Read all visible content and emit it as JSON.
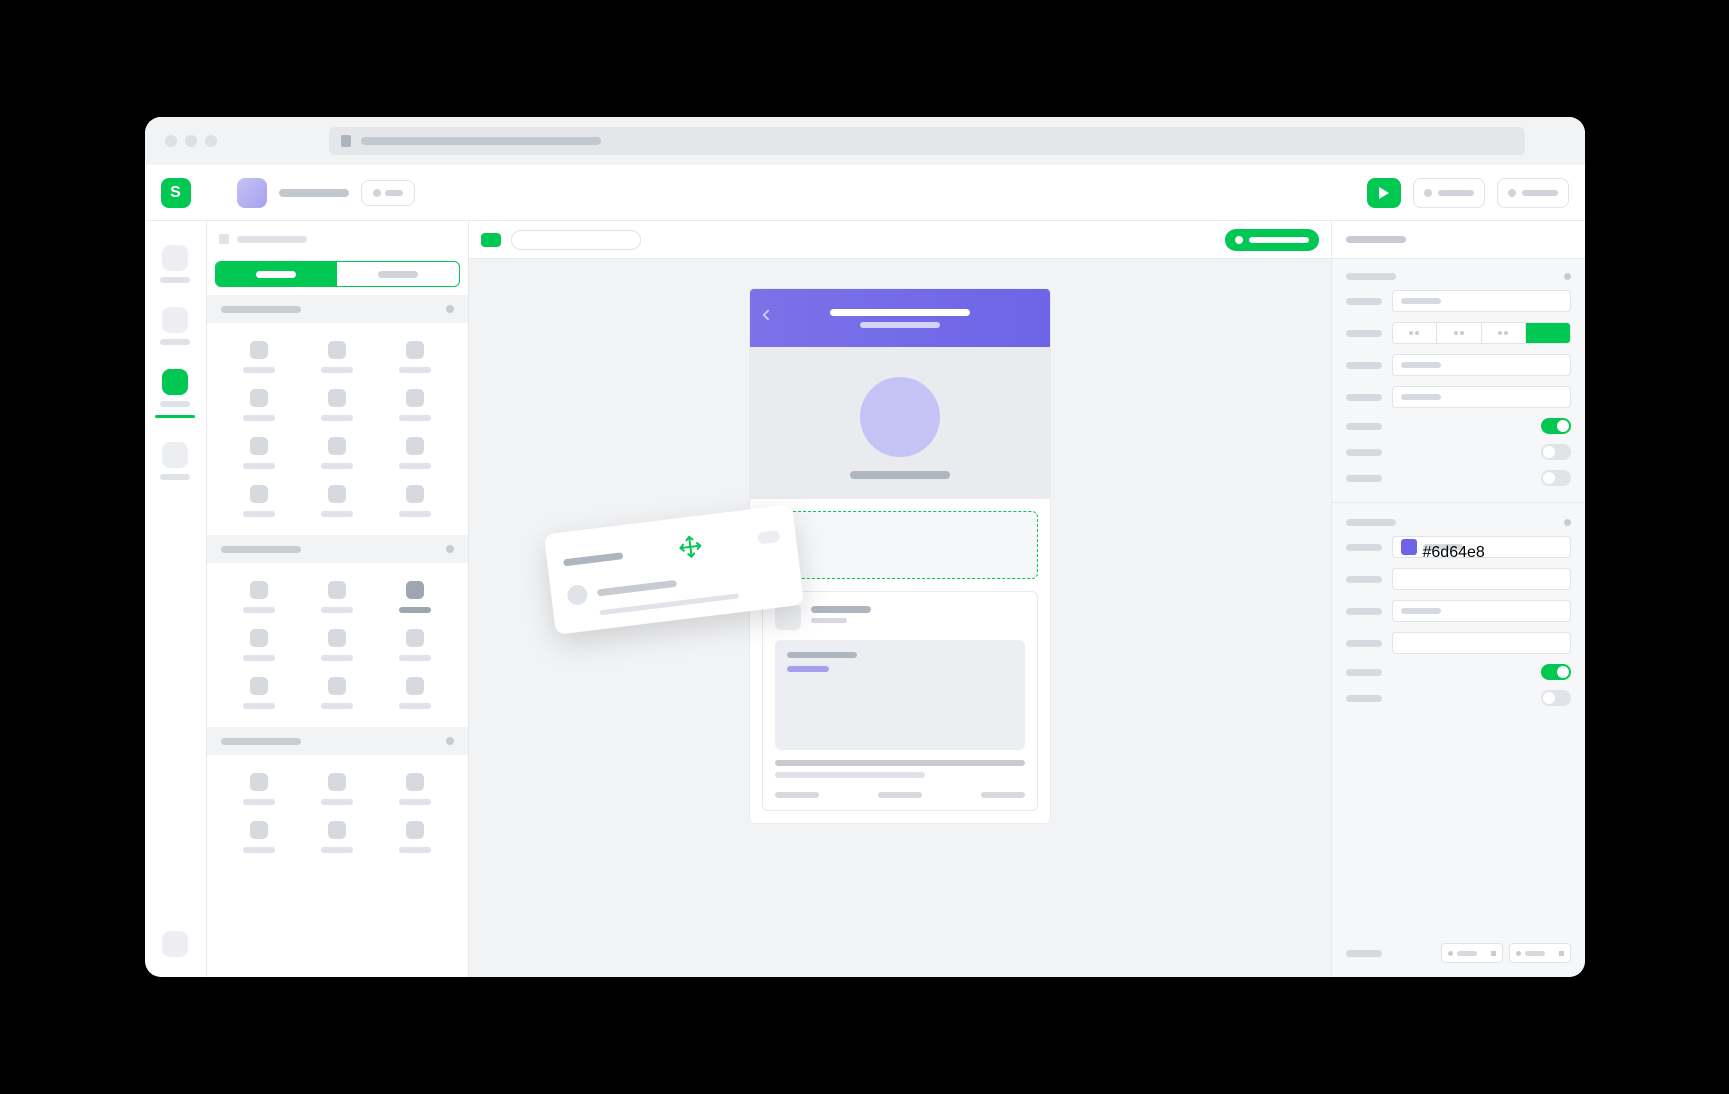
{
  "browser": {
    "url_placeholder": ""
  },
  "toolbar": {
    "logo_letter": "S",
    "project_name": "",
    "play_label": "",
    "action1": "",
    "action2": ""
  },
  "rail": {
    "items": [
      {
        "label": "",
        "active": false
      },
      {
        "label": "",
        "active": false
      },
      {
        "label": "",
        "active": true
      },
      {
        "label": "",
        "active": false
      }
    ]
  },
  "left_panel": {
    "header": "",
    "segments": [
      "",
      ""
    ],
    "active_segment": 0,
    "sections": [
      {
        "title": "",
        "items": [
          "",
          "",
          "",
          "",
          "",
          "",
          "",
          "",
          "",
          "",
          "",
          ""
        ]
      },
      {
        "title": "",
        "items": [
          "",
          "",
          "",
          "",
          "",
          "",
          "",
          "",
          ""
        ]
      },
      {
        "title": "",
        "items": [
          "",
          "",
          "",
          "",
          "",
          ""
        ]
      }
    ]
  },
  "canvas": {
    "badge": "",
    "input_placeholder": "",
    "status_pill": ""
  },
  "phone": {
    "header_title": "",
    "header_subtitle": "",
    "profile_name": "",
    "card": {
      "title": "",
      "subtitle": "",
      "body_title": "",
      "body_tag": "",
      "description": "",
      "actions": [
        "",
        "",
        ""
      ]
    }
  },
  "drag_component": {
    "title": "",
    "name": "",
    "meta": ""
  },
  "right_panel": {
    "header": "",
    "section1_title": "",
    "rows": [
      {
        "label": "",
        "type": "input",
        "value": ""
      },
      {
        "label": "",
        "type": "segment4"
      },
      {
        "label": "",
        "type": "input",
        "value": ""
      },
      {
        "label": "",
        "type": "input",
        "value": ""
      },
      {
        "label": "",
        "type": "switch",
        "on": true
      },
      {
        "label": "",
        "type": "switch",
        "on": false
      },
      {
        "label": "",
        "type": "switch",
        "on": false
      }
    ],
    "section2_title": "",
    "color_value": "#6d64e8",
    "rows2": [
      {
        "label": "",
        "type": "color-input"
      },
      {
        "label": "",
        "type": "input"
      },
      {
        "label": "",
        "type": "input",
        "value": ""
      },
      {
        "label": "",
        "type": "input"
      },
      {
        "label": "",
        "type": "switch",
        "on": true
      },
      {
        "label": "",
        "type": "switch",
        "on": false
      }
    ],
    "footer_inputs": [
      "",
      ""
    ]
  },
  "colors": {
    "accent_green": "#00c853",
    "accent_purple": "#6d64e8"
  }
}
